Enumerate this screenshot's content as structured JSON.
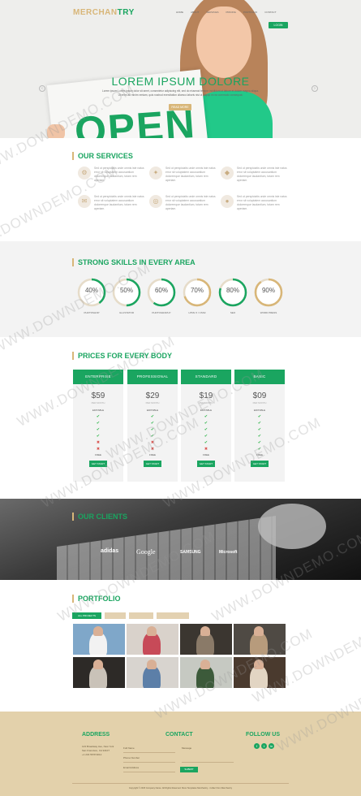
{
  "brand": {
    "part1": "MERCHAN",
    "part2": "TRY"
  },
  "nav": [
    "HOME",
    "ABOUT",
    "SERVICES",
    "PRICING",
    "PORTFOLIO",
    "CONTACT"
  ],
  "header": {
    "login_label": "LOGIN"
  },
  "hero": {
    "title": "LOREM IPSUM DOLORE",
    "subtitle": "Lorem ipsum Lorem ipsum dolor sit amet, consectetur adipiscing elit, sed do eiusmod tempor incididunt ut labore et dolore magna aliqua.",
    "subtitle2": "Ut enim ad minim veniam, quis nostrud exercitation ullamco laboris nisi ut aliquip ex ea commodo consequat.",
    "button_label": "READ MORE",
    "sign_text": "OPEN"
  },
  "services": {
    "title": "OUR SERVICES",
    "items": [
      {
        "icon": "gear-icon",
        "glyph": "⚙",
        "text": "Sed ut perspiciatis unde omnis iste natus error sit voluptatem accusantium doloremque laudantium, totam rem aperiam."
      },
      {
        "icon": "star-icon",
        "glyph": "✦",
        "text": "Sed ut perspiciatis unde omnis iste natus error sit voluptatem accusantium doloremque laudantium, totam rem aperiam."
      },
      {
        "icon": "diamond-icon",
        "glyph": "◆",
        "text": "Sed ut perspiciatis unde omnis iste natus error sit voluptatem accusantium doloremque laudantium, totam rem aperiam."
      },
      {
        "icon": "chat-icon",
        "glyph": "✉",
        "text": "Sed ut perspiciatis unde omnis iste natus error sit voluptatem accusantium doloremque laudantium, totam rem aperiam."
      },
      {
        "icon": "globe-icon",
        "glyph": "◎",
        "text": "Sed ut perspiciatis unde omnis iste natus error sit voluptatem accusantium doloremque laudantium, totam rem aperiam."
      },
      {
        "icon": "user-icon",
        "glyph": "●",
        "text": "Sed ut perspiciatis unde omnis iste natus error sit voluptatem accusantium doloremque laudantium, totam rem aperiam."
      }
    ]
  },
  "skills": {
    "title": "STRONG SKILLS IN EVERY AREA",
    "items": [
      {
        "value": "40%",
        "fraction": 0.4,
        "label": "PHOTOSHOP",
        "color": "#1aa560"
      },
      {
        "value": "50%",
        "fraction": 0.5,
        "label": "ILLUSTATOR",
        "color": "#1aa560"
      },
      {
        "value": "60%",
        "fraction": 0.6,
        "label": "PHOTOGRAPHY",
        "color": "#1aa560"
      },
      {
        "value": "70%",
        "fraction": 0.7,
        "label": "HTML 5 / CSS3",
        "color": "#d8b678"
      },
      {
        "value": "80%",
        "fraction": 0.8,
        "label": "SEO",
        "color": "#1aa560"
      },
      {
        "value": "90%",
        "fraction": 0.9,
        "label": "WORD PRESS",
        "color": "#d8b678"
      }
    ]
  },
  "pricing": {
    "title": "PRICES FOR EVERY BODY",
    "plans": [
      {
        "name": "ENTERPRISE",
        "price": "$59",
        "per": "PER MONTH",
        "feature": "EDITABLE",
        "marks": [
          "y",
          "y",
          "y",
          "y",
          "n",
          "n"
        ],
        "free": "FREE",
        "button": "GET START"
      },
      {
        "name": "PROFESSIONAL",
        "price": "$29",
        "per": "PER MONTH",
        "feature": "EDITABLE",
        "marks": [
          "y",
          "y",
          "y",
          "y",
          "n",
          "n"
        ],
        "free": "FREE",
        "button": "GET START"
      },
      {
        "name": "STANDARD",
        "price": "$19",
        "per": "PER MONTH",
        "feature": "EDITABLE",
        "marks": [
          "y",
          "y",
          "y",
          "y",
          "y",
          "n"
        ],
        "free": "FREE",
        "button": "GET START"
      },
      {
        "name": "BASIC",
        "price": "$09",
        "per": "PER MONTH",
        "feature": "EDITABLE",
        "marks": [
          "y",
          "y",
          "y",
          "y",
          "y",
          "y"
        ],
        "free": "FREE",
        "button": "GET START"
      }
    ]
  },
  "clients": {
    "title": "OUR CLIENTS",
    "logos": [
      "adidas",
      "Google",
      "SAMSUNG",
      "Microsoft"
    ]
  },
  "portfolio": {
    "title": "PORTFOLIO",
    "tabs": [
      "ALL PROJECTS",
      "",
      "",
      ""
    ],
    "photos": [
      {
        "bg": "#7fa7c9",
        "person": "#f2f2f2"
      },
      {
        "bg": "#d9d2cb",
        "person": "#c74a58"
      },
      {
        "bg": "#3b3630",
        "person": "#8a7a68"
      },
      {
        "bg": "#4f4a44",
        "person": "#b79b7c"
      },
      {
        "bg": "#2d2a27",
        "person": "#c9c2b8"
      },
      {
        "bg": "#d8d4cf",
        "person": "#5c7fa8"
      },
      {
        "bg": "#c6c9c2",
        "person": "#3c5a3a"
      },
      {
        "bg": "#4a3a2e",
        "person": "#e2d5c3"
      }
    ]
  },
  "footer": {
    "address_title": "ADDRESS",
    "address_lines": [
      "123 Broadway Ave, New York",
      "San Francisco, CA 94107",
      "+1 234 5678 9012"
    ],
    "contact_title": "CONTACT",
    "name_label": "Full Name",
    "email_label": "Email Address",
    "phone_label": "Phone Number",
    "message_label": "Message",
    "submit_label": "SUBMIT",
    "follow_title": "FOLLOW US",
    "social": [
      {
        "icon": "facebook-icon",
        "glyph": "f"
      },
      {
        "icon": "twitter-icon",
        "glyph": "t"
      },
      {
        "icon": "linkedin-icon",
        "glyph": "in"
      }
    ],
    "copyright": "Copyright © 2015 Company Name. All Rights Reserved. More Templates Merchantry - Collect from Merchantry"
  },
  "watermark": "WWW.DOWNDEMO.COM"
}
